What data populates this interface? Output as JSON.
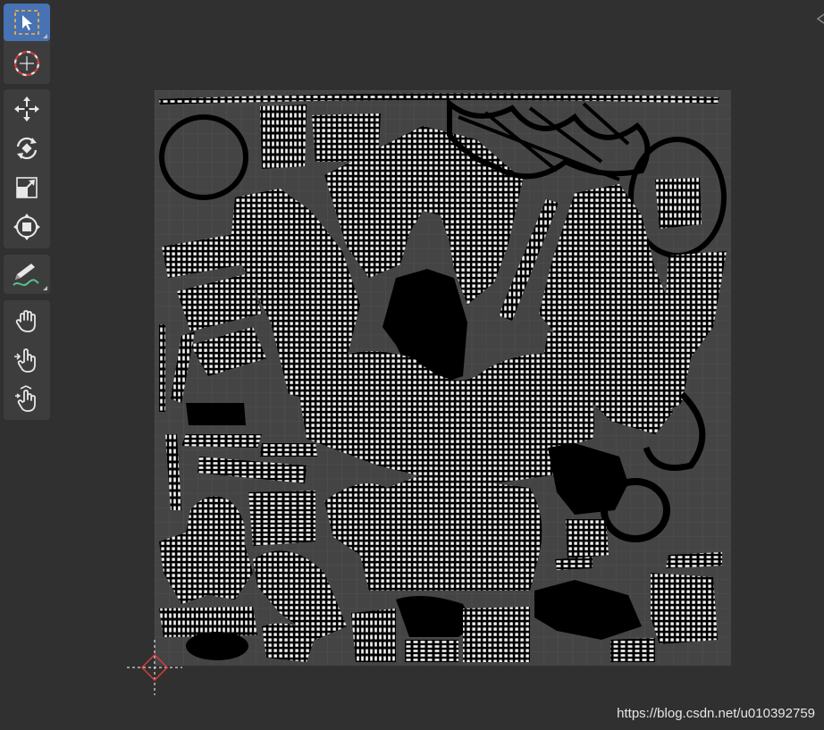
{
  "toolbar": {
    "tools": [
      {
        "name": "select-box-tool",
        "icon": "select-box-icon",
        "active": true
      },
      {
        "name": "cursor-tool",
        "icon": "cursor-icon",
        "active": false
      },
      {
        "name": "move-tool",
        "icon": "move-icon",
        "active": false
      },
      {
        "name": "rotate-tool",
        "icon": "rotate-icon",
        "active": false
      },
      {
        "name": "scale-tool",
        "icon": "scale-icon",
        "active": false
      },
      {
        "name": "transform-tool",
        "icon": "transform-icon",
        "active": false
      },
      {
        "name": "annotate-tool",
        "icon": "annotate-icon",
        "active": false
      },
      {
        "name": "grab-tool",
        "icon": "grab-hand-icon",
        "active": false
      },
      {
        "name": "relax-tool",
        "icon": "relax-hand-icon",
        "active": false
      },
      {
        "name": "pinch-tool",
        "icon": "pinch-hand-icon",
        "active": false
      }
    ]
  },
  "colors": {
    "background": "#303030",
    "toolbar_bg": "#3d3d3d",
    "active_tool": "#4772b3",
    "uv_grid_bg": "#444444",
    "uv_island": "#000000",
    "uv_edge": "#ffffff"
  },
  "watermark": "https://blog.csdn.net/u010392759"
}
